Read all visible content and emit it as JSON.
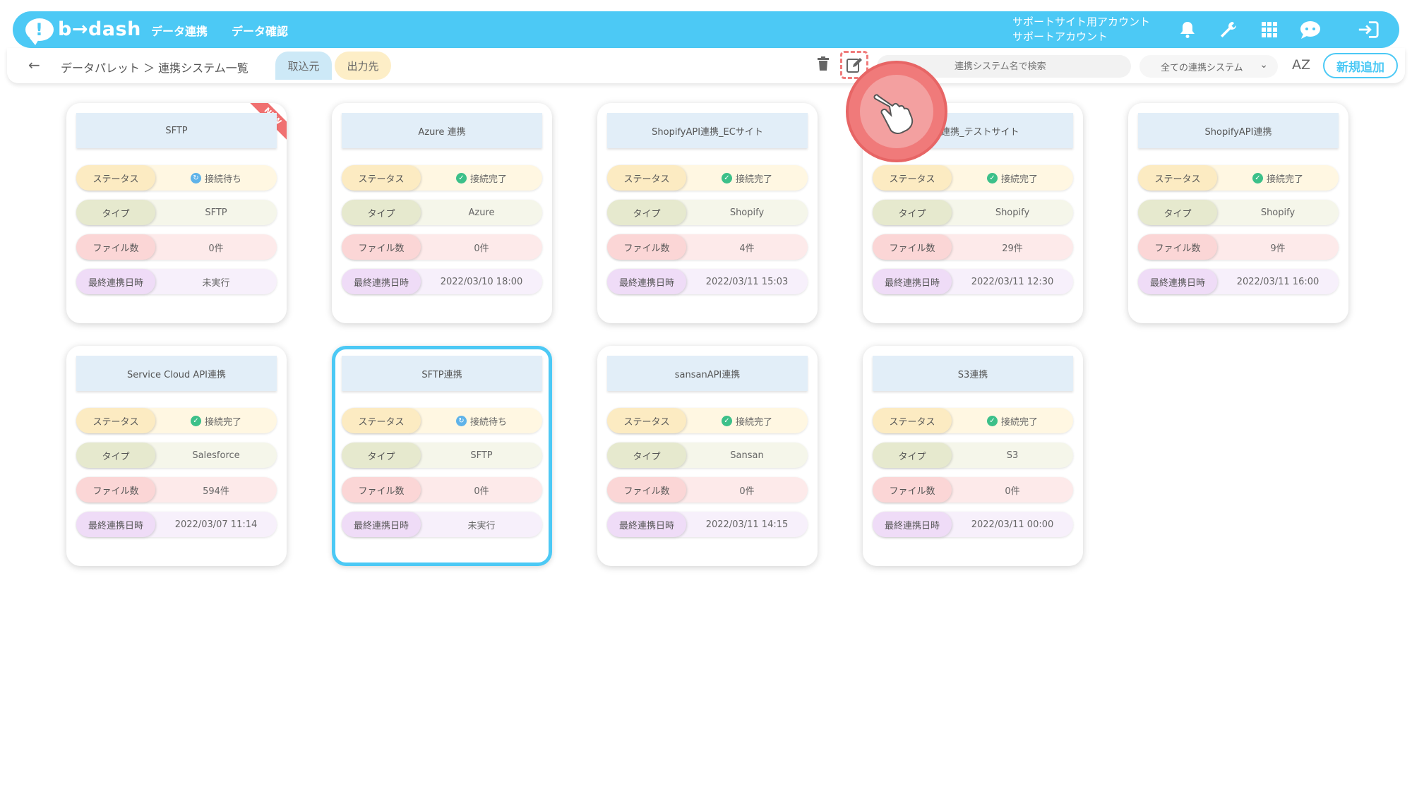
{
  "header": {
    "logo_text": "b→dash",
    "logo_mark": "!",
    "nav": [
      "データ連携",
      "データ確認"
    ],
    "account_line1": "サポートサイト用アカウント",
    "account_line2": "サポートアカウント",
    "icons": [
      "bell-icon",
      "wrench-icon",
      "grid-icon",
      "chat-icon",
      "logout-icon"
    ]
  },
  "toolbar": {
    "breadcrumb": "データパレット ＞ 連携システム一覧",
    "tab_in": "取込元",
    "tab_out": "出力先",
    "search_placeholder": "連携システム名で検索",
    "filter_value": "全ての連携システム",
    "sort_label": "AZ",
    "new_button": "新規追加"
  },
  "labels": {
    "status": "ステータス",
    "type": "タイプ",
    "files": "ファイル数",
    "last": "最終連携日時",
    "new_badge": "NEW"
  },
  "cards": [
    {
      "title": "SFTP",
      "status": "接続待ち",
      "status_kind": "wait",
      "type": "SFTP",
      "files": "0件",
      "last": "未実行",
      "new": true
    },
    {
      "title": "Azure 連携",
      "status": "接続完了",
      "status_kind": "ok",
      "type": "Azure",
      "files": "0件",
      "last": "2022/03/10 18:00"
    },
    {
      "title": "ShopifyAPI連携_ECサイト",
      "status": "接続完了",
      "status_kind": "ok",
      "type": "Shopify",
      "files": "4件",
      "last": "2022/03/11 15:03"
    },
    {
      "title": "API連携_テストサイト",
      "status": "接続完了",
      "status_kind": "ok",
      "type": "Shopify",
      "files": "29件",
      "last": "2022/03/11 12:30"
    },
    {
      "title": "ShopifyAPI連携",
      "status": "接続完了",
      "status_kind": "ok",
      "type": "Shopify",
      "files": "9件",
      "last": "2022/03/11 16:00"
    },
    {
      "title": "Service Cloud API連携",
      "status": "接続完了",
      "status_kind": "ok",
      "type": "Salesforce",
      "files": "594件",
      "last": "2022/03/07 11:14"
    },
    {
      "title": "SFTP連携",
      "status": "接続待ち",
      "status_kind": "wait",
      "type": "SFTP",
      "files": "0件",
      "last": "未実行",
      "selected": true
    },
    {
      "title": "sansanAPI連携",
      "status": "接続完了",
      "status_kind": "ok",
      "type": "Sansan",
      "files": "0件",
      "last": "2022/03/11 14:15"
    },
    {
      "title": "S3連携",
      "status": "接続完了",
      "status_kind": "ok",
      "type": "S3",
      "files": "0件",
      "last": "2022/03/11 00:00"
    }
  ],
  "colors": {
    "brand": "#4cc9f5",
    "ok": "#3cc089",
    "wait": "#5fb3e9",
    "highlight": "#f07a7a"
  }
}
